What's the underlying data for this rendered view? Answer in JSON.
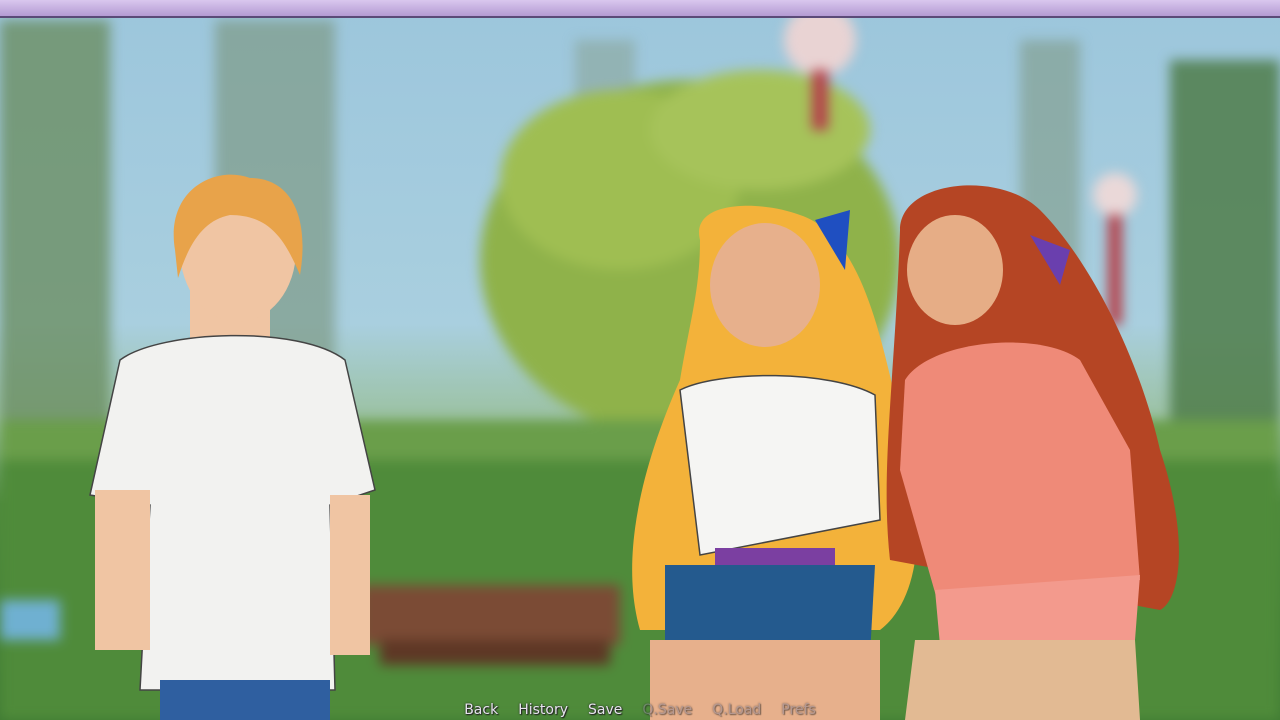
{
  "quick_menu": {
    "items": [
      {
        "label": "Back",
        "enabled": true
      },
      {
        "label": "History",
        "enabled": true
      },
      {
        "label": "Save",
        "enabled": true
      },
      {
        "label": "Q.Save",
        "enabled": false
      },
      {
        "label": "Q.Load",
        "enabled": false
      },
      {
        "label": "Prefs",
        "enabled": false
      }
    ]
  },
  "colors": {
    "sky": "#9cc6dc",
    "grass": "#4e8a3c",
    "topbar": "#c8b3e3",
    "menu_text": "#e6e2ee"
  }
}
